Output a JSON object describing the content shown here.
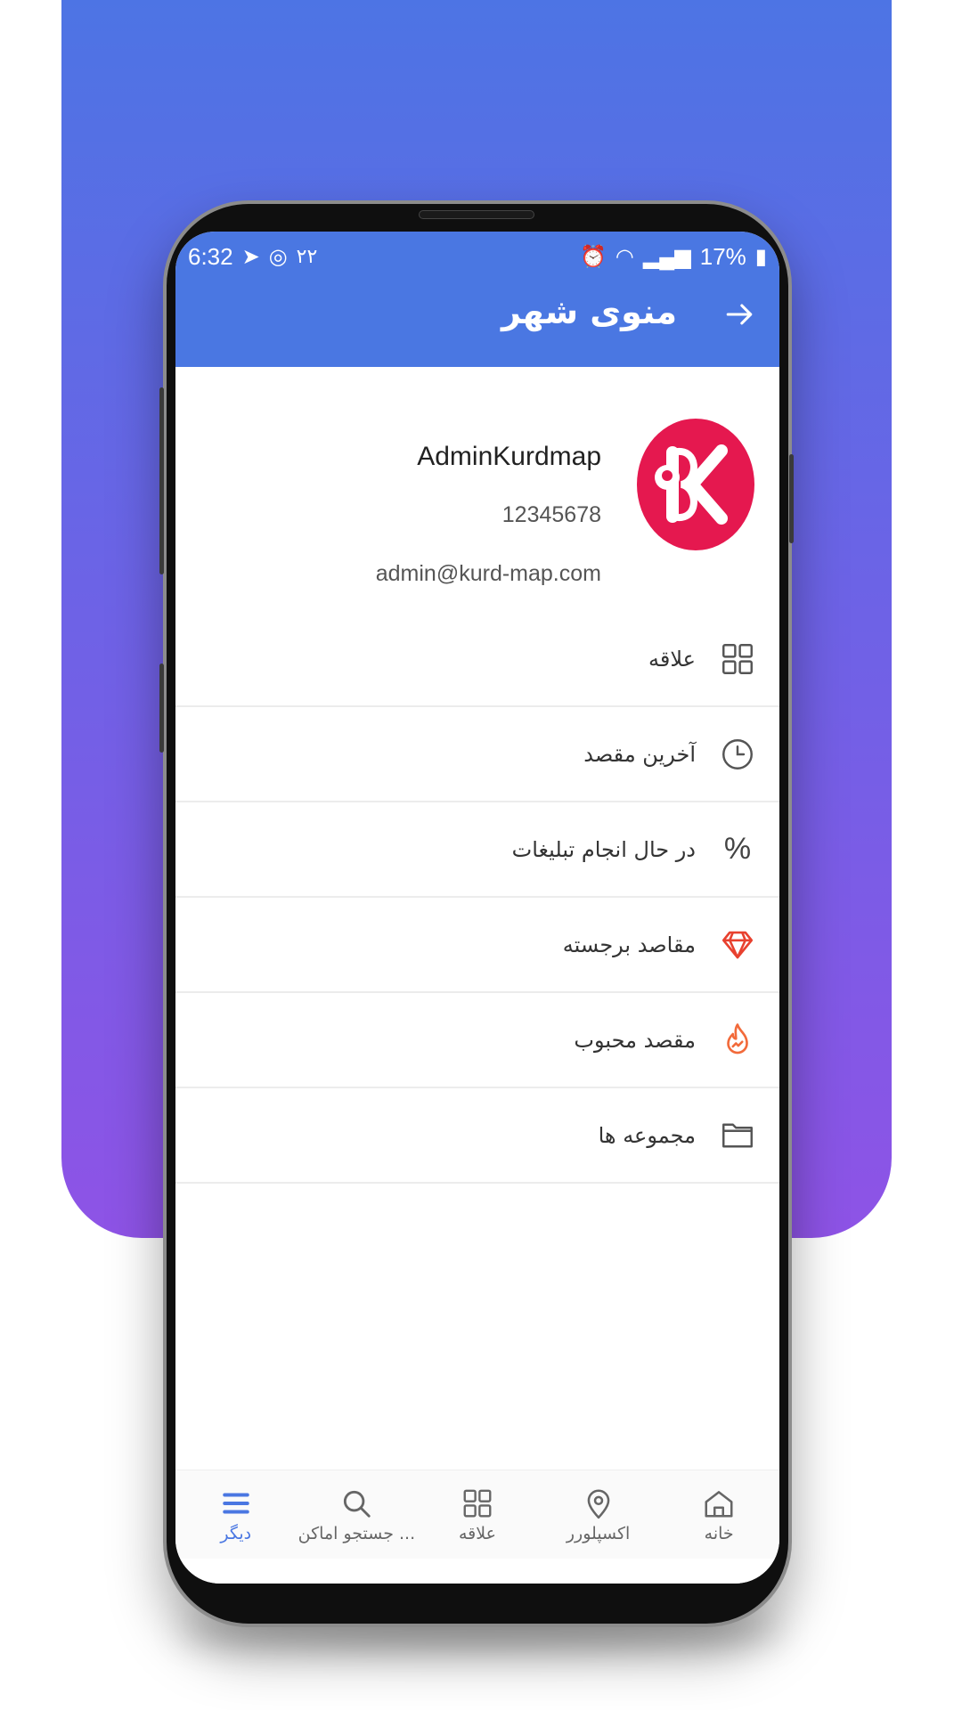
{
  "status_bar": {
    "time": "6:32",
    "extra": "۲۲",
    "battery": "17%"
  },
  "app_bar": {
    "title": "منوی شهر"
  },
  "profile": {
    "name": "AdminKurdmap",
    "phone": "12345678",
    "email": "admin@kurd-map.com"
  },
  "menu": {
    "items": [
      {
        "label": "علاقه",
        "icon": "grid-icon"
      },
      {
        "label": "آخرین مقصد",
        "icon": "clock-icon"
      },
      {
        "label": "در حال انجام تبلیغات",
        "icon": "percent-icon",
        "glyph": "%"
      },
      {
        "label": "مقاصد برجسته",
        "icon": "diamond-icon"
      },
      {
        "label": "مقصد محبوب",
        "icon": "fire-icon"
      },
      {
        "label": "مجموعه ها",
        "icon": "folder-icon"
      }
    ]
  },
  "bottom_nav": {
    "items": [
      {
        "label": "دیگر",
        "icon": "menu-icon",
        "active": true
      },
      {
        "label": "جستجو اماکن ...",
        "icon": "search-icon",
        "active": false
      },
      {
        "label": "علاقه",
        "icon": "grid-icon",
        "active": false
      },
      {
        "label": "اکسپلورر",
        "icon": "location-pin-icon",
        "active": false
      },
      {
        "label": "خانه",
        "icon": "home-icon",
        "active": false
      }
    ]
  },
  "colors": {
    "accent": "#4a77e2",
    "gradient_top": "#4d74e4",
    "gradient_bottom": "#8e53e6",
    "logo": "#e5184f",
    "diamond": "#e8412f",
    "fire": "#f26a3a"
  }
}
